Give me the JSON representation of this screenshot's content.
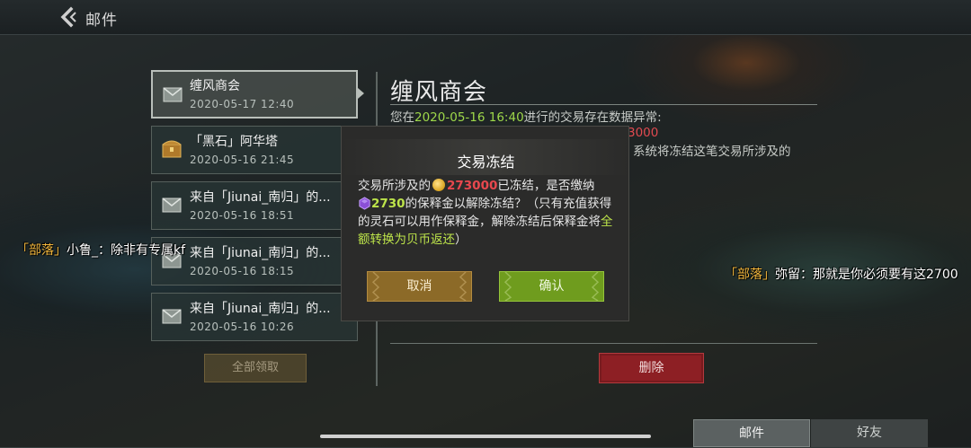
{
  "header": {
    "title": "邮件",
    "back_icon": "chevron-left-icon"
  },
  "mail_list": [
    {
      "title": "缠风商会",
      "time": "2020-05-17  12:40",
      "icon": "envelope-icon",
      "selected": true
    },
    {
      "title": "「黑石」阿华塔",
      "time": "2020-05-16  21:45",
      "icon": "treasure-chest-icon",
      "selected": false
    },
    {
      "title": "来自「Jiunai_南归」的...",
      "time": "2020-05-16  18:51",
      "icon": "envelope-icon",
      "selected": false
    },
    {
      "title": "来自「Jiunai_南归」的...",
      "time": "2020-05-16  18:15",
      "icon": "envelope-icon",
      "selected": false
    },
    {
      "title": "来自「Jiunai_南归」的...",
      "time": "2020-05-16  10:26",
      "icon": "envelope-icon",
      "selected": false
    }
  ],
  "collect_all_label": "全部领取",
  "detail": {
    "title": "缠风商会",
    "line1_prefix": "您在",
    "line1_date": "2020-05-16  16:40",
    "line1_suffix": "进行的交易存在数据异常:",
    "amount_partial": "3000",
    "line2_partial": "系统将冻结这笔交易所涉及的",
    "delete_label": "删除"
  },
  "chat": [
    {
      "tag": "「部落」",
      "text": "小鲁_：除非有专属kf"
    },
    {
      "tag": "「部落」",
      "text": "弥留：那就是你必须要有这2700"
    }
  ],
  "dialog": {
    "title": "交易冻结",
    "msg_a": "交易所涉及的",
    "coin_amount": "273000",
    "msg_b": "已冻结，是否缴纳",
    "gem_amount": "2730",
    "msg_c": "的保释金以解除冻结？（只有充值获得的灵石可以用作保释金，解除冻结后保释金将",
    "msg_highlight": "全额转换为贝币返还",
    "msg_d": "）",
    "cancel_label": "取消",
    "confirm_label": "确认"
  },
  "tabs": [
    {
      "label": "邮件",
      "active": true
    },
    {
      "label": "好友",
      "active": false
    }
  ],
  "colors": {
    "confirm": "#6f9c1e",
    "cancel": "#8c6a28",
    "delete": "#8d1f24",
    "coin_amount": "#e8484e",
    "gem_amount": "#bde44a",
    "chat_tag": "#f2b63c"
  }
}
